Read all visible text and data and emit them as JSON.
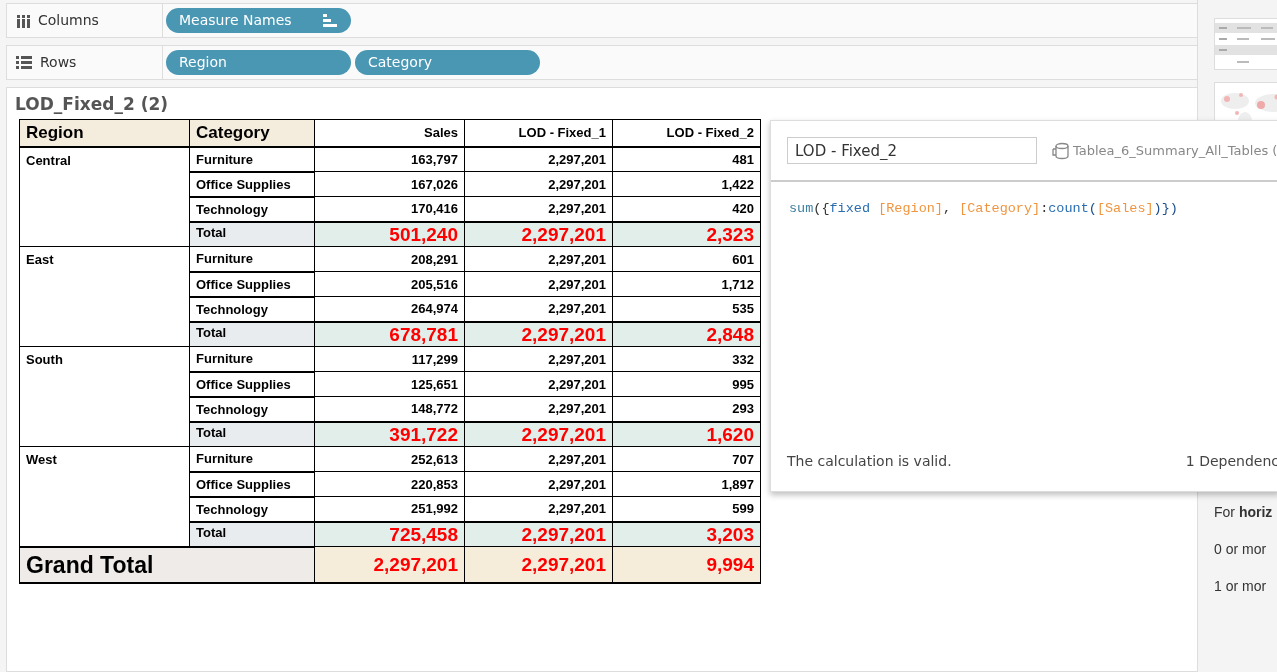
{
  "shelves": [
    {
      "kind": "columns",
      "label": "Columns",
      "pills": [
        {
          "label": "Measure Names",
          "sort": true
        }
      ]
    },
    {
      "kind": "rows",
      "label": "Rows",
      "pills": [
        {
          "label": "Region",
          "sort": false
        },
        {
          "label": "Category",
          "sort": false
        }
      ]
    }
  ],
  "sheet": {
    "title": "LOD_Fixed_2 (2)",
    "table": {
      "columns": [
        "Region",
        "Category",
        "Sales",
        "LOD - Fixed_1",
        "LOD - Fixed_2"
      ],
      "groups": [
        {
          "region": "Central",
          "rows": [
            {
              "category": "Furniture",
              "values": [
                "163,797",
                "2,297,201",
                "481"
              ]
            },
            {
              "category": "Office Supplies",
              "values": [
                "167,026",
                "2,297,201",
                "1,422"
              ]
            },
            {
              "category": "Technology",
              "values": [
                "170,416",
                "2,297,201",
                "420"
              ]
            }
          ],
          "total": {
            "label": "Total",
            "values": [
              "501,240",
              "2,297,201",
              "2,323"
            ]
          }
        },
        {
          "region": "East",
          "rows": [
            {
              "category": "Furniture",
              "values": [
                "208,291",
                "2,297,201",
                "601"
              ]
            },
            {
              "category": "Office Supplies",
              "values": [
                "205,516",
                "2,297,201",
                "1,712"
              ]
            },
            {
              "category": "Technology",
              "values": [
                "264,974",
                "2,297,201",
                "535"
              ]
            }
          ],
          "total": {
            "label": "Total",
            "values": [
              "678,781",
              "2,297,201",
              "2,848"
            ]
          }
        },
        {
          "region": "South",
          "rows": [
            {
              "category": "Furniture",
              "values": [
                "117,299",
                "2,297,201",
                "332"
              ]
            },
            {
              "category": "Office Supplies",
              "values": [
                "125,651",
                "2,297,201",
                "995"
              ]
            },
            {
              "category": "Technology",
              "values": [
                "148,772",
                "2,297,201",
                "293"
              ]
            }
          ],
          "total": {
            "label": "Total",
            "values": [
              "391,722",
              "2,297,201",
              "1,620"
            ]
          }
        },
        {
          "region": "West",
          "rows": [
            {
              "category": "Furniture",
              "values": [
                "252,613",
                "2,297,201",
                "707"
              ]
            },
            {
              "category": "Office Supplies",
              "values": [
                "220,853",
                "2,297,201",
                "1,897"
              ]
            },
            {
              "category": "Technology",
              "values": [
                "251,992",
                "2,297,201",
                "599"
              ]
            }
          ],
          "total": {
            "label": "Total",
            "values": [
              "725,458",
              "2,297,201",
              "3,203"
            ]
          }
        }
      ],
      "grand_total": {
        "label": "Grand Total",
        "values": [
          "2,297,201",
          "2,297,201",
          "9,994"
        ]
      }
    }
  },
  "side_panel": {
    "thumbnails": [
      {
        "kind": "picture"
      },
      {
        "kind": "picture"
      }
    ],
    "texts": [
      "For **horiz**",
      "0 or mor",
      "1 or mor"
    ]
  },
  "calc_dialog": {
    "name_value": "LOD - Fixed_2",
    "datasource": "Tablea_6_Summary_All_Tables (",
    "formula": [
      {
        "kind": "func",
        "text": "sum"
      },
      {
        "kind": "punct",
        "text": "({"
      },
      {
        "kind": "keyword",
        "text": "fixed "
      },
      {
        "kind": "field",
        "text": "[Region]"
      },
      {
        "kind": "punct",
        "text": ", "
      },
      {
        "kind": "field",
        "text": "[Category]"
      },
      {
        "kind": "punct",
        "text": ":"
      },
      {
        "kind": "keyword",
        "text": "count"
      },
      {
        "kind": "paren",
        "text": "("
      },
      {
        "kind": "field",
        "text": "[Sales]"
      },
      {
        "kind": "paren",
        "text": ")})"
      }
    ],
    "status": "The calculation is valid.",
    "dependencies": "1 Dependenc"
  }
}
